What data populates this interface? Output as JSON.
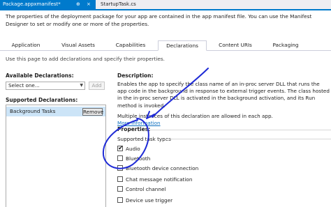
{
  "doc_tabs": {
    "active": "Package.appxmanifest*",
    "inactive": "StartupTask.cs",
    "pin_glyph": "⊕",
    "close_glyph": "×"
  },
  "info_text": "The properties of the deployment package for your app are contained in the app manifest file. You can use the Manifest Designer to set or modify one or more of the properties.",
  "tabs": [
    "Application",
    "Visual Assets",
    "Capabilities",
    "Declarations",
    "Content URIs",
    "Packaging"
  ],
  "active_tab": "Declarations",
  "hint": "Use this page to add declarations and specify their properties.",
  "left": {
    "available_title": "Available Declarations:",
    "select_value": "Select one...",
    "add_label": "Add",
    "supported_title": "Supported Declarations:",
    "items": [
      {
        "label": "Background Tasks",
        "remove_label": "Remove"
      }
    ]
  },
  "right": {
    "description_title": "Description:",
    "description": "Enables the app to specify the class name of an in-proc server DLL that runs the app code in the background in response to external trigger events. The class hosted in the in-proc server DLL is activated in the background activation, and its Run method is invoked.",
    "multiple_note": "Multiple instances of this declaration are allowed in each app.",
    "more_info": "More information",
    "properties_title": "Properties:",
    "supported_task_types": "Supported task types",
    "task_types": [
      {
        "label": "Audio",
        "checked": true
      },
      {
        "label": "Bluetooth",
        "checked": false
      },
      {
        "label": "Bluetooth device connection",
        "checked": false
      },
      {
        "label": "Chat message notification",
        "checked": false
      },
      {
        "label": "Control channel",
        "checked": false
      },
      {
        "label": "Device use trigger",
        "checked": false
      }
    ]
  },
  "colors": {
    "accent": "#007acc",
    "selection": "#cce4f7",
    "ink": "#1f2bd6",
    "link": "#0e70c0"
  }
}
